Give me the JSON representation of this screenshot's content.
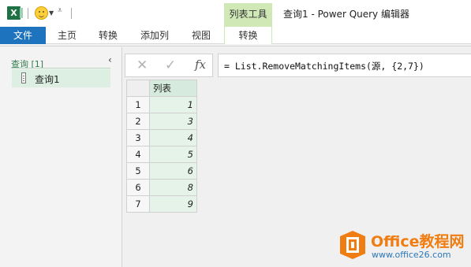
{
  "quick_access": {
    "excel_icon_letter": "X",
    "customize_glyph": "⩡"
  },
  "window": {
    "title": "查询1 - Power Query 编辑器",
    "context_group_label": "列表工具"
  },
  "ribbon": {
    "tabs": [
      {
        "label": "文件"
      },
      {
        "label": "主页"
      },
      {
        "label": "转换"
      },
      {
        "label": "添加列"
      },
      {
        "label": "视图"
      },
      {
        "label": "转换"
      }
    ]
  },
  "queries_pane": {
    "header": "查询 [1]",
    "collapse_glyph": "‹",
    "items": [
      {
        "label": "查询1"
      }
    ]
  },
  "formula_bar": {
    "cancel_glyph": "✕",
    "commit_glyph": "✓",
    "fx_label": "fx",
    "formula": "= List.RemoveMatchingItems(源, {2,7})"
  },
  "grid": {
    "column_header": "列表",
    "row_numbers": [
      "1",
      "2",
      "3",
      "4",
      "5",
      "6",
      "7"
    ],
    "values": [
      "1",
      "3",
      "4",
      "5",
      "6",
      "8",
      "9"
    ]
  },
  "watermark": {
    "brand": "Office教程网",
    "url": "www.office26.com",
    "brand_color": "#f07d12"
  },
  "colors": {
    "file_tab": "#1e73be",
    "context_tab": "#cfe8b6",
    "selected_query": "#dcefe2",
    "column_cells": "#e5f3e9"
  }
}
